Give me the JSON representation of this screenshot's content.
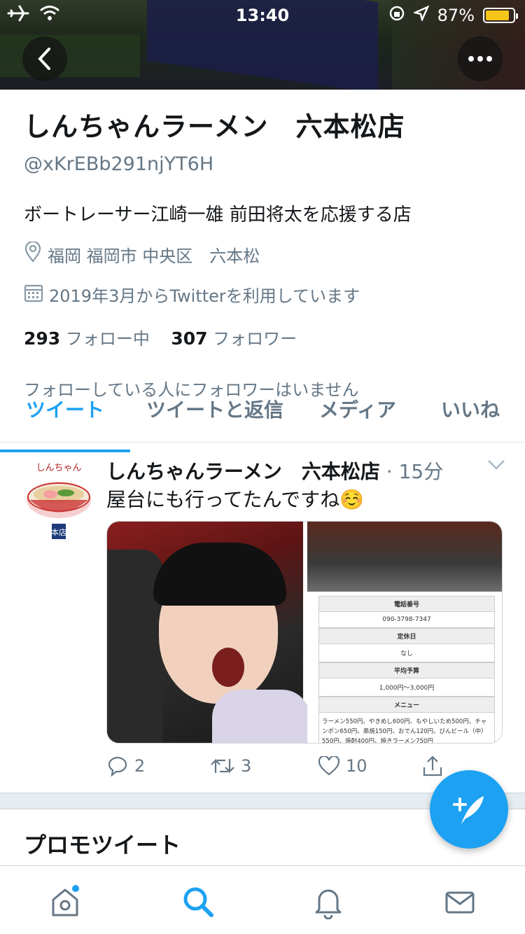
{
  "status_bar": {
    "time": "13:40",
    "battery": "87%"
  },
  "profile": {
    "name": "しんちゃんラーメン　六本松店",
    "handle": "@xKrEBb291njYT6H",
    "bio": "ボートレーサー江崎一雄 前田将太を応援する店",
    "location": "福岡 福岡市 中央区　六本松",
    "joined": "2019年3月からTwitterを利用しています",
    "following_count": "293",
    "following_label": "フォロー中",
    "followers_count": "307",
    "followers_label": "フォロワー",
    "no_mutual": "フォローしている人にフォロワーはいません"
  },
  "tabs": [
    {
      "label": "ツイート",
      "active": true
    },
    {
      "label": "ツイートと返信",
      "active": false
    },
    {
      "label": "メディア",
      "active": false
    },
    {
      "label": "いいね",
      "active": false
    }
  ],
  "tweet": {
    "author": "しんちゃんラーメン　六本松店",
    "time": "15分",
    "text": "屋台にも行ってたんですね☺️",
    "avatar_text": "しんちゃん",
    "avatar_sub": "本店",
    "replies": "2",
    "retweets": "3",
    "likes": "10",
    "info_card": {
      "phone_label": "電話番号",
      "phone": "090-3798-7347",
      "holiday_label": "定休日",
      "holiday": "なし",
      "budget_label": "平均予算",
      "budget": "1,000円〜3,000円",
      "menu_label": "メニュー",
      "menu": "ラーメン550円、やきめし600円、もやしいため500円、チャンポン650円、串焼150円、おでん120円、びんビール（中）550円、焼酎400円、焼きラーメン750円"
    }
  },
  "section": {
    "promo_title": "プロモツイート"
  },
  "colors": {
    "accent": "#1da1f2",
    "secondary_text": "#657786"
  }
}
